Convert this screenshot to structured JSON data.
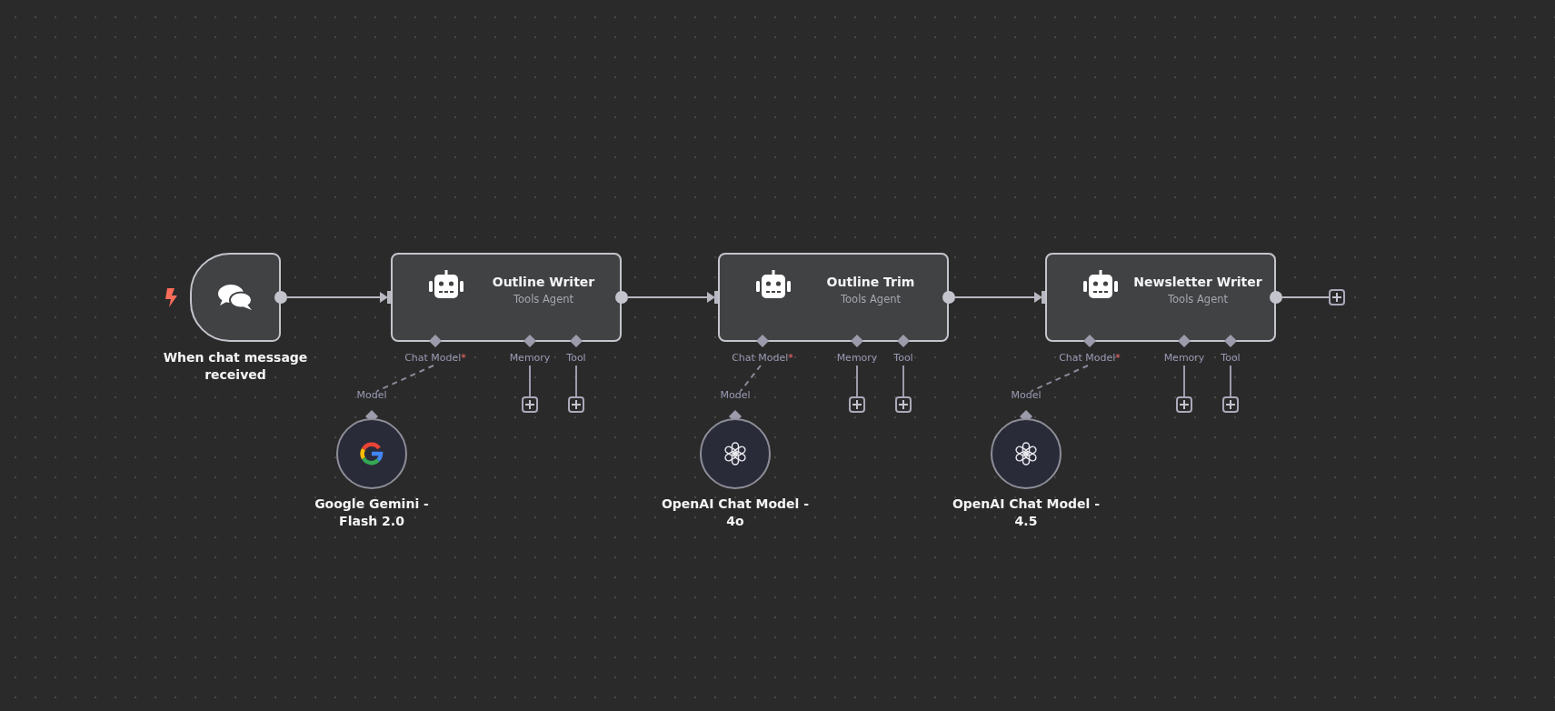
{
  "trigger": {
    "label": "When chat message received"
  },
  "agents": [
    {
      "title": "Outline Writer",
      "subtitle": "Tools Agent",
      "ports": [
        {
          "label": "Chat Model",
          "required_mark": "*",
          "model": {
            "input_label": "Model",
            "name": "Google Gemini - Flash 2.0",
            "kind": "google"
          }
        },
        {
          "label": "Memory"
        },
        {
          "label": "Tool"
        }
      ]
    },
    {
      "title": "Outline Trim",
      "subtitle": "Tools Agent",
      "ports": [
        {
          "label": "Chat Model",
          "required_mark": "*",
          "model": {
            "input_label": "Model",
            "name": "OpenAI Chat Model - 4o",
            "kind": "openai"
          }
        },
        {
          "label": "Memory"
        },
        {
          "label": "Tool"
        }
      ]
    },
    {
      "title": "Newsletter Writer",
      "subtitle": "Tools Agent",
      "ports": [
        {
          "label": "Chat Model",
          "required_mark": "*",
          "model": {
            "input_label": "Model",
            "name": "OpenAI Chat Model - 4.5",
            "kind": "openai"
          }
        },
        {
          "label": "Memory"
        },
        {
          "label": "Tool"
        }
      ]
    }
  ],
  "trailing_add": true
}
